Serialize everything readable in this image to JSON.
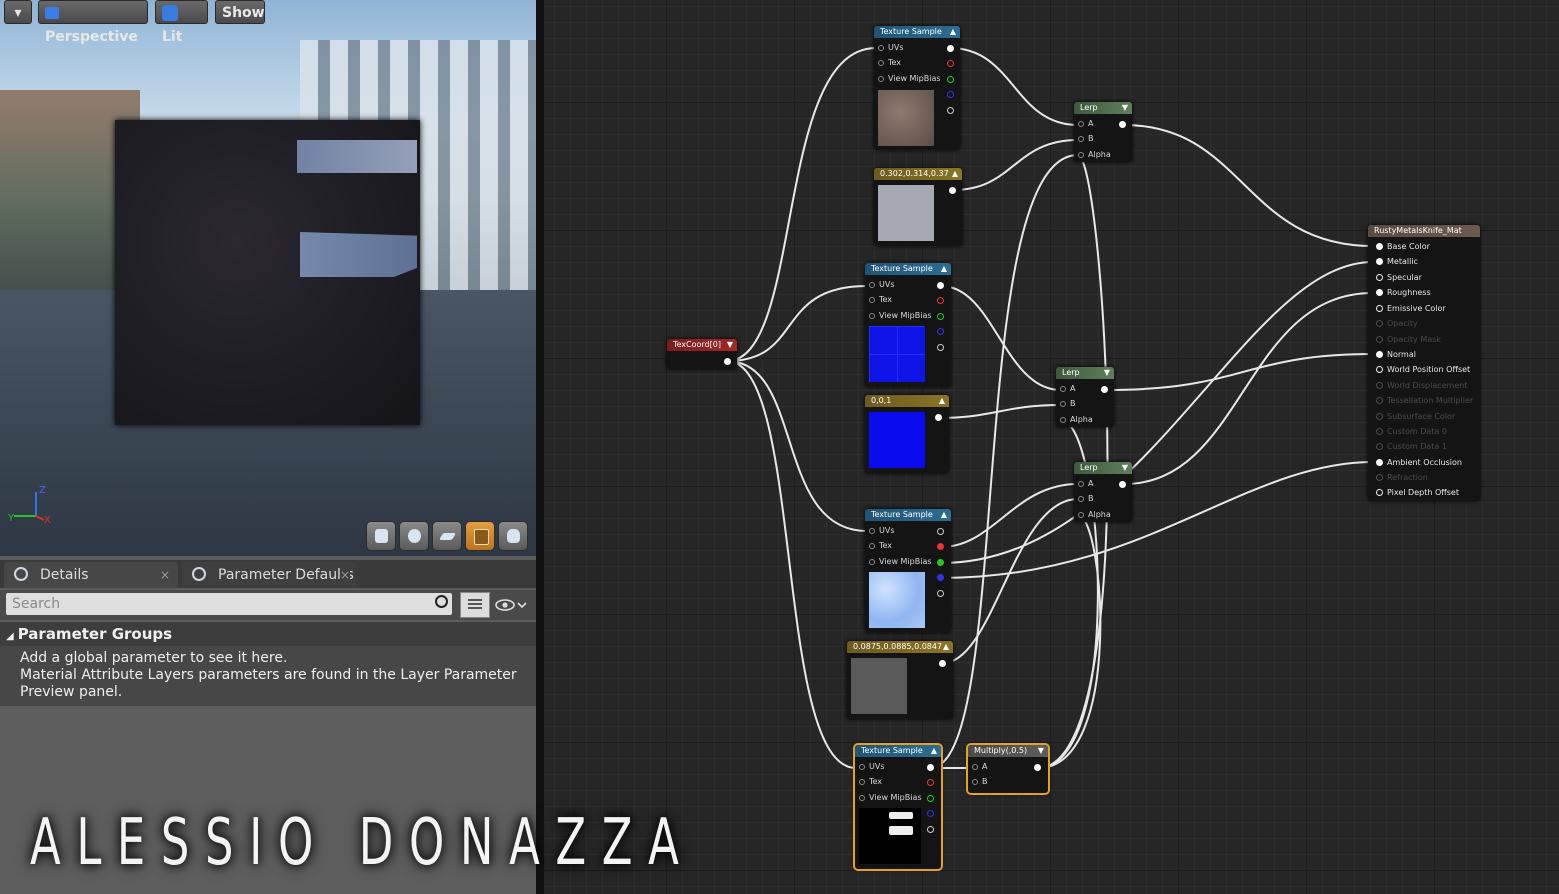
{
  "viewport": {
    "buttons": {
      "menu": "▾",
      "perspective": "Perspective",
      "lit": "Lit",
      "show": "Show"
    },
    "axes": {
      "z": "Z",
      "y": "Y",
      "x": "X"
    },
    "preview_tools": [
      "cylinder-icon",
      "sphere-icon",
      "plane-icon",
      "cube-icon",
      "teapot-icon"
    ]
  },
  "tabs": [
    {
      "label": "Details",
      "close": "×"
    },
    {
      "label": "Parameter Defaults",
      "close": "×"
    }
  ],
  "search": {
    "placeholder": "Search"
  },
  "parameter_groups": {
    "title": "Parameter Groups",
    "line1": "Add a global parameter to see it here.",
    "line2": "Material Attribute Layers parameters are found in the Layer Parameter",
    "line3": "Preview panel."
  },
  "watermark": "ALESSIO DONAZZA",
  "graph": {
    "texcoord": {
      "title": "TexCoord[0]"
    },
    "tex1": {
      "title": "Texture Sample",
      "pins": [
        "UVs",
        "Tex",
        "View MipBias"
      ]
    },
    "const1": {
      "title": "0.302,0.314,0.37"
    },
    "tex2": {
      "title": "Texture Sample",
      "pins": [
        "UVs",
        "Tex",
        "View MipBias"
      ]
    },
    "const2": {
      "title": "0,0,1"
    },
    "tex3": {
      "title": "Texture Sample",
      "pins": [
        "UVs",
        "Tex",
        "View MipBias"
      ]
    },
    "const3": {
      "title": "0.0875,0.0885,0.0847"
    },
    "tex4": {
      "title": "Texture Sample",
      "pins": [
        "UVs",
        "Tex",
        "View MipBias"
      ]
    },
    "multiply": {
      "title": "Multiply(,0.5)",
      "pins": [
        "A",
        "B"
      ]
    },
    "lerp1": {
      "title": "Lerp",
      "pins": [
        "A",
        "B",
        "Alpha"
      ]
    },
    "lerp2": {
      "title": "Lerp",
      "pins": [
        "A",
        "B",
        "Alpha"
      ]
    },
    "lerp3": {
      "title": "Lerp",
      "pins": [
        "A",
        "B",
        "Alpha"
      ]
    },
    "material": {
      "title": "RustyMetalsKnife_Mat",
      "pins": [
        "Base Color",
        "Metallic",
        "Specular",
        "Roughness",
        "Emissive Color",
        "Opacity",
        "Opacity Mask",
        "Normal",
        "World Position Offset",
        "World Displacement",
        "Tessellation Multiplier",
        "Subsurface Color",
        "Custom Data 0",
        "Custom Data 1",
        "Ambient Occlusion",
        "Refraction",
        "Pixel Depth Offset"
      ]
    }
  },
  "colors": {
    "accent_selection": "#e8a020",
    "texture_header": "#2d6d92",
    "constant_header": "#8a7426",
    "lerp_header": "#5f7f5c",
    "texcoord_header": "#a52727"
  }
}
